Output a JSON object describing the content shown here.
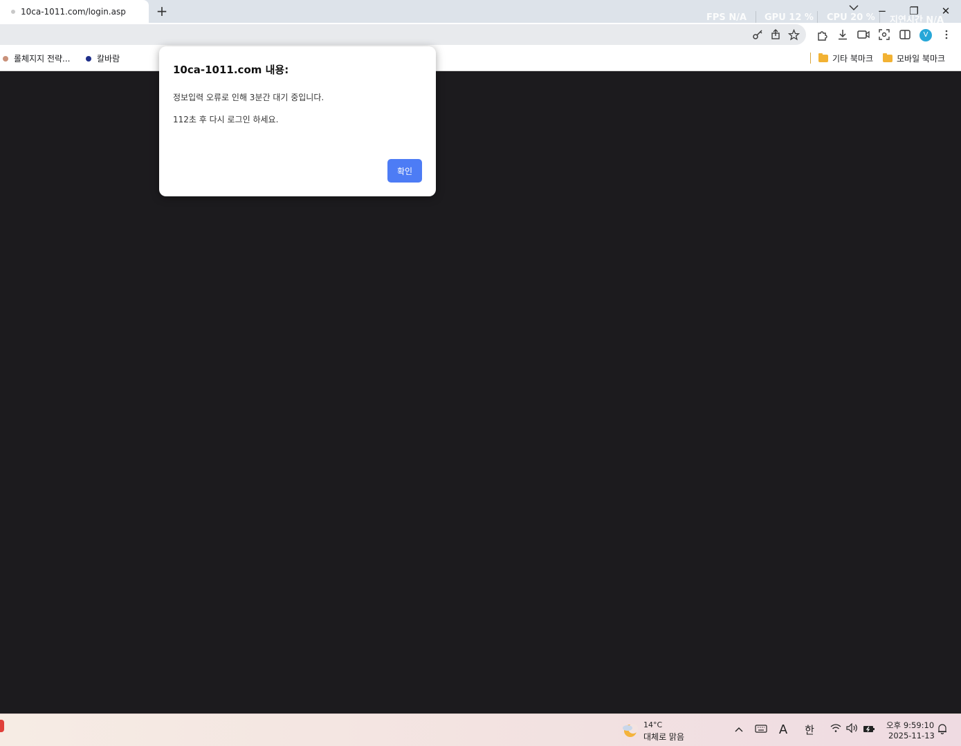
{
  "browser": {
    "tab_title": "10ca-1011.com/login.asp",
    "new_tab_symbol": "+",
    "overlay": {
      "fps_label": "FPS",
      "fps_value": "N/A",
      "gpu_label": "GPU",
      "gpu_value": "12 %",
      "cpu_label": "CPU",
      "cpu_value": "20 %",
      "latency_label": "지연시간",
      "latency_value": "N/A"
    },
    "window_controls": {
      "minimize": "−",
      "restore": "❐",
      "close": "✕"
    },
    "toolbar": {
      "avatar_letter": "V",
      "icons": [
        "key-icon",
        "share-icon",
        "bookmark-star-icon",
        "extensions-icon",
        "download-icon",
        "camera-icon",
        "screenshot-icon",
        "split-view-icon",
        "more-menu-icon"
      ]
    },
    "bookmarks": {
      "items": [
        {
          "label": "롤체지지 전략...",
          "color": "#c9917a"
        },
        {
          "label": "칼바람",
          "color": "#1f2f8a"
        }
      ],
      "folders": [
        {
          "label": "기타 북마크"
        },
        {
          "label": "모바일 북마크"
        }
      ]
    }
  },
  "dialog": {
    "title": "10ca-1011.com 내용:",
    "message_line1": "정보입력 오류로 인해 3분간 대기 중입니다.",
    "message_line2": "112초 후 다시 로그인 하세요.",
    "ok_label": "확인"
  },
  "taskbar": {
    "weather_temp": "14°C",
    "weather_desc": "대체로 맑음",
    "ime_mode": "A",
    "ime_lang": "한",
    "time": "오후 9:59:10",
    "date": "2025-11-13"
  },
  "colors": {
    "page_bg": "#1c1b1e",
    "accent_button": "#4d7cf5",
    "tabstrip_bg": "#dde3ea"
  }
}
